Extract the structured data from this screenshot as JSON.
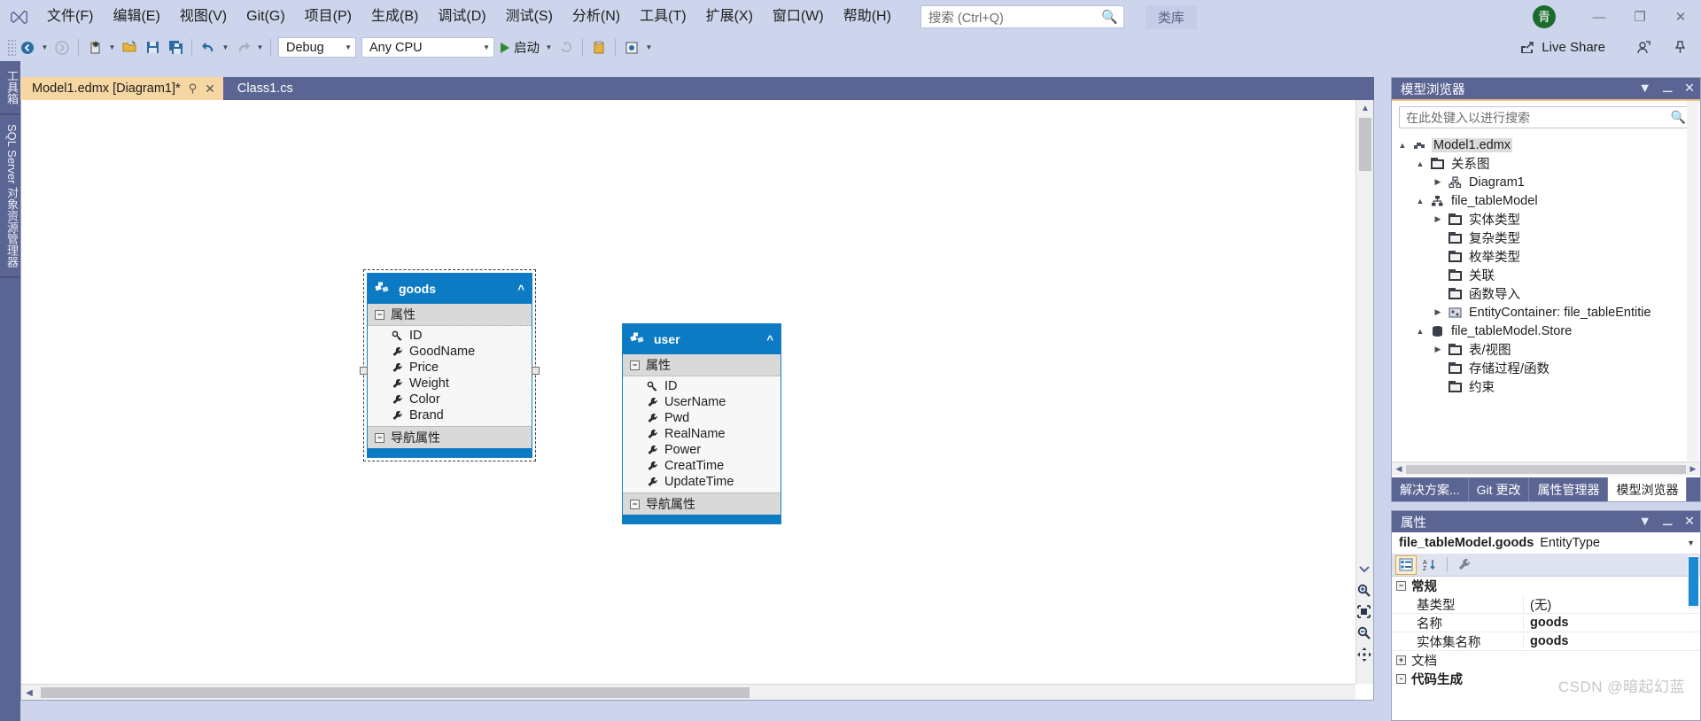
{
  "menu": {
    "items": [
      "文件(F)",
      "编辑(E)",
      "视图(V)",
      "Git(G)",
      "项目(P)",
      "生成(B)",
      "调试(D)",
      "测试(S)",
      "分析(N)",
      "工具(T)",
      "扩展(X)",
      "窗口(W)",
      "帮助(H)"
    ],
    "search_placeholder": "搜索 (Ctrl+Q)",
    "class_library_label": "类库",
    "avatar_initial": "青",
    "window_buttons": {
      "minimize": "—",
      "maximize": "❐",
      "close": "✕"
    }
  },
  "toolbar": {
    "configuration": "Debug",
    "platform": "Any CPU",
    "run_label": "启动",
    "live_share_label": "Live Share"
  },
  "leftdock": {
    "tabs": [
      "工具箱",
      "SQL Server 对象资源管理器"
    ]
  },
  "tabs": [
    {
      "label": "Model1.edmx [Diagram1]*",
      "active": true,
      "pin": "⚲",
      "close": "✕"
    },
    {
      "label": "Class1.cs",
      "active": false
    }
  ],
  "designer": {
    "entities": [
      {
        "name": "goods",
        "attributes_header": "属性",
        "navigation_header": "导航属性",
        "properties": [
          "ID",
          "GoodName",
          "Price",
          "Weight",
          "Color",
          "Brand"
        ],
        "selected": true
      },
      {
        "name": "user",
        "attributes_header": "属性",
        "navigation_header": "导航属性",
        "properties": [
          "ID",
          "UserName",
          "Pwd",
          "RealName",
          "Power",
          "CreatTime",
          "UpdateTime"
        ],
        "selected": false
      }
    ]
  },
  "model_browser": {
    "title": "模型浏览器",
    "search_placeholder": "在此处键入以进行搜索",
    "tree": [
      {
        "label": "Model1.edmx",
        "depth": 0,
        "twisty": "▲",
        "icon": "edmx",
        "selected": true
      },
      {
        "label": "关系图",
        "depth": 1,
        "twisty": "▲",
        "icon": "folder"
      },
      {
        "label": "Diagram1",
        "depth": 2,
        "twisty": "▶",
        "icon": "diagram"
      },
      {
        "label": "file_tableModel",
        "depth": 1,
        "twisty": "▲",
        "icon": "model"
      },
      {
        "label": "实体类型",
        "depth": 2,
        "twisty": "▶",
        "icon": "folder"
      },
      {
        "label": "复杂类型",
        "depth": 2,
        "twisty": "",
        "icon": "folder"
      },
      {
        "label": "枚举类型",
        "depth": 2,
        "twisty": "",
        "icon": "folder"
      },
      {
        "label": "关联",
        "depth": 2,
        "twisty": "",
        "icon": "folder"
      },
      {
        "label": "函数导入",
        "depth": 2,
        "twisty": "",
        "icon": "folder"
      },
      {
        "label": "EntityContainer: file_tableEntitie",
        "depth": 2,
        "twisty": "▶",
        "icon": "container"
      },
      {
        "label": "file_tableModel.Store",
        "depth": 1,
        "twisty": "▲",
        "icon": "store"
      },
      {
        "label": "表/视图",
        "depth": 2,
        "twisty": "▶",
        "icon": "folder"
      },
      {
        "label": "存储过程/函数",
        "depth": 2,
        "twisty": "",
        "icon": "folder"
      },
      {
        "label": "约束",
        "depth": 2,
        "twisty": "",
        "icon": "folder"
      }
    ],
    "bottom_tabs": [
      {
        "label": "解决方案...",
        "active": false
      },
      {
        "label": "Git 更改",
        "active": false
      },
      {
        "label": "属性管理器",
        "active": false
      },
      {
        "label": "模型浏览器",
        "active": true
      }
    ]
  },
  "properties": {
    "title": "属性",
    "object_name": "file_tableModel.goods",
    "object_type": "EntityType",
    "group_label": "常规",
    "rows": [
      {
        "key": "基类型",
        "value": "(无)",
        "bold": false
      },
      {
        "key": "名称",
        "value": "goods",
        "bold": true
      },
      {
        "key": "实体集名称",
        "value": "goods",
        "bold": true
      }
    ],
    "doc_row": {
      "key": "文档",
      "expander": "+"
    },
    "codegen_row": {
      "key": "代码生成",
      "expander": "-"
    }
  },
  "watermark": "CSDN @暗起幻蓝",
  "colors": {
    "chrome": "#ccd5ec",
    "dock": "#5b6593",
    "entity_header": "#0d7bc4",
    "active_tab": "#f6d6a3",
    "accent": "#f0c375"
  }
}
